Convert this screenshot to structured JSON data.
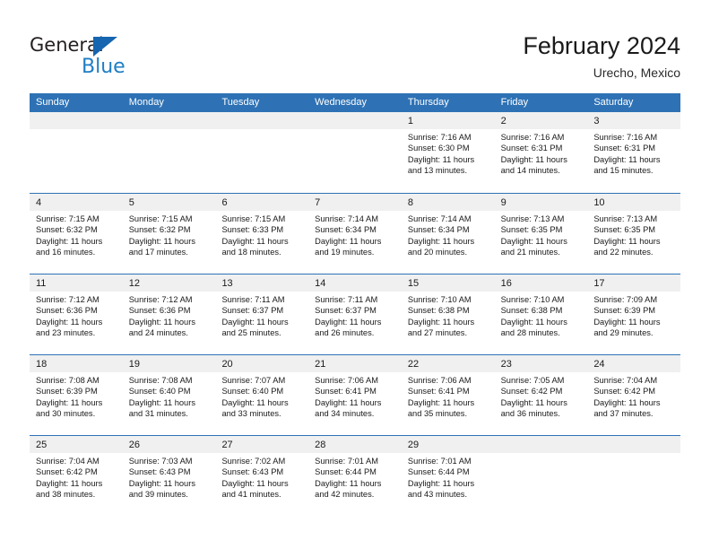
{
  "brand": {
    "name_part1": "General",
    "name_part2": "Blue",
    "triangle_icon": "blue-triangle-icon",
    "accent_color": "#1f7ec4"
  },
  "header": {
    "title": "February 2024",
    "subtitle": "Urecho, Mexico"
  },
  "theme": {
    "header_row_bg": "#2e72b5",
    "day_strip_bg": "#f0f0f0",
    "row_divider": "#2e72b5",
    "text": "#1a1a1a"
  },
  "weekdays": [
    "Sunday",
    "Monday",
    "Tuesday",
    "Wednesday",
    "Thursday",
    "Friday",
    "Saturday"
  ],
  "weeks": [
    [
      {
        "day": "",
        "sunrise": "",
        "sunset": "",
        "daylight_line1": "",
        "daylight_line2": ""
      },
      {
        "day": "",
        "sunrise": "",
        "sunset": "",
        "daylight_line1": "",
        "daylight_line2": ""
      },
      {
        "day": "",
        "sunrise": "",
        "sunset": "",
        "daylight_line1": "",
        "daylight_line2": ""
      },
      {
        "day": "",
        "sunrise": "",
        "sunset": "",
        "daylight_line1": "",
        "daylight_line2": ""
      },
      {
        "day": "1",
        "sunrise": "Sunrise: 7:16 AM",
        "sunset": "Sunset: 6:30 PM",
        "daylight_line1": "Daylight: 11 hours",
        "daylight_line2": "and 13 minutes."
      },
      {
        "day": "2",
        "sunrise": "Sunrise: 7:16 AM",
        "sunset": "Sunset: 6:31 PM",
        "daylight_line1": "Daylight: 11 hours",
        "daylight_line2": "and 14 minutes."
      },
      {
        "day": "3",
        "sunrise": "Sunrise: 7:16 AM",
        "sunset": "Sunset: 6:31 PM",
        "daylight_line1": "Daylight: 11 hours",
        "daylight_line2": "and 15 minutes."
      }
    ],
    [
      {
        "day": "4",
        "sunrise": "Sunrise: 7:15 AM",
        "sunset": "Sunset: 6:32 PM",
        "daylight_line1": "Daylight: 11 hours",
        "daylight_line2": "and 16 minutes."
      },
      {
        "day": "5",
        "sunrise": "Sunrise: 7:15 AM",
        "sunset": "Sunset: 6:32 PM",
        "daylight_line1": "Daylight: 11 hours",
        "daylight_line2": "and 17 minutes."
      },
      {
        "day": "6",
        "sunrise": "Sunrise: 7:15 AM",
        "sunset": "Sunset: 6:33 PM",
        "daylight_line1": "Daylight: 11 hours",
        "daylight_line2": "and 18 minutes."
      },
      {
        "day": "7",
        "sunrise": "Sunrise: 7:14 AM",
        "sunset": "Sunset: 6:34 PM",
        "daylight_line1": "Daylight: 11 hours",
        "daylight_line2": "and 19 minutes."
      },
      {
        "day": "8",
        "sunrise": "Sunrise: 7:14 AM",
        "sunset": "Sunset: 6:34 PM",
        "daylight_line1": "Daylight: 11 hours",
        "daylight_line2": "and 20 minutes."
      },
      {
        "day": "9",
        "sunrise": "Sunrise: 7:13 AM",
        "sunset": "Sunset: 6:35 PM",
        "daylight_line1": "Daylight: 11 hours",
        "daylight_line2": "and 21 minutes."
      },
      {
        "day": "10",
        "sunrise": "Sunrise: 7:13 AM",
        "sunset": "Sunset: 6:35 PM",
        "daylight_line1": "Daylight: 11 hours",
        "daylight_line2": "and 22 minutes."
      }
    ],
    [
      {
        "day": "11",
        "sunrise": "Sunrise: 7:12 AM",
        "sunset": "Sunset: 6:36 PM",
        "daylight_line1": "Daylight: 11 hours",
        "daylight_line2": "and 23 minutes."
      },
      {
        "day": "12",
        "sunrise": "Sunrise: 7:12 AM",
        "sunset": "Sunset: 6:36 PM",
        "daylight_line1": "Daylight: 11 hours",
        "daylight_line2": "and 24 minutes."
      },
      {
        "day": "13",
        "sunrise": "Sunrise: 7:11 AM",
        "sunset": "Sunset: 6:37 PM",
        "daylight_line1": "Daylight: 11 hours",
        "daylight_line2": "and 25 minutes."
      },
      {
        "day": "14",
        "sunrise": "Sunrise: 7:11 AM",
        "sunset": "Sunset: 6:37 PM",
        "daylight_line1": "Daylight: 11 hours",
        "daylight_line2": "and 26 minutes."
      },
      {
        "day": "15",
        "sunrise": "Sunrise: 7:10 AM",
        "sunset": "Sunset: 6:38 PM",
        "daylight_line1": "Daylight: 11 hours",
        "daylight_line2": "and 27 minutes."
      },
      {
        "day": "16",
        "sunrise": "Sunrise: 7:10 AM",
        "sunset": "Sunset: 6:38 PM",
        "daylight_line1": "Daylight: 11 hours",
        "daylight_line2": "and 28 minutes."
      },
      {
        "day": "17",
        "sunrise": "Sunrise: 7:09 AM",
        "sunset": "Sunset: 6:39 PM",
        "daylight_line1": "Daylight: 11 hours",
        "daylight_line2": "and 29 minutes."
      }
    ],
    [
      {
        "day": "18",
        "sunrise": "Sunrise: 7:08 AM",
        "sunset": "Sunset: 6:39 PM",
        "daylight_line1": "Daylight: 11 hours",
        "daylight_line2": "and 30 minutes."
      },
      {
        "day": "19",
        "sunrise": "Sunrise: 7:08 AM",
        "sunset": "Sunset: 6:40 PM",
        "daylight_line1": "Daylight: 11 hours",
        "daylight_line2": "and 31 minutes."
      },
      {
        "day": "20",
        "sunrise": "Sunrise: 7:07 AM",
        "sunset": "Sunset: 6:40 PM",
        "daylight_line1": "Daylight: 11 hours",
        "daylight_line2": "and 33 minutes."
      },
      {
        "day": "21",
        "sunrise": "Sunrise: 7:06 AM",
        "sunset": "Sunset: 6:41 PM",
        "daylight_line1": "Daylight: 11 hours",
        "daylight_line2": "and 34 minutes."
      },
      {
        "day": "22",
        "sunrise": "Sunrise: 7:06 AM",
        "sunset": "Sunset: 6:41 PM",
        "daylight_line1": "Daylight: 11 hours",
        "daylight_line2": "and 35 minutes."
      },
      {
        "day": "23",
        "sunrise": "Sunrise: 7:05 AM",
        "sunset": "Sunset: 6:42 PM",
        "daylight_line1": "Daylight: 11 hours",
        "daylight_line2": "and 36 minutes."
      },
      {
        "day": "24",
        "sunrise": "Sunrise: 7:04 AM",
        "sunset": "Sunset: 6:42 PM",
        "daylight_line1": "Daylight: 11 hours",
        "daylight_line2": "and 37 minutes."
      }
    ],
    [
      {
        "day": "25",
        "sunrise": "Sunrise: 7:04 AM",
        "sunset": "Sunset: 6:42 PM",
        "daylight_line1": "Daylight: 11 hours",
        "daylight_line2": "and 38 minutes."
      },
      {
        "day": "26",
        "sunrise": "Sunrise: 7:03 AM",
        "sunset": "Sunset: 6:43 PM",
        "daylight_line1": "Daylight: 11 hours",
        "daylight_line2": "and 39 minutes."
      },
      {
        "day": "27",
        "sunrise": "Sunrise: 7:02 AM",
        "sunset": "Sunset: 6:43 PM",
        "daylight_line1": "Daylight: 11 hours",
        "daylight_line2": "and 41 minutes."
      },
      {
        "day": "28",
        "sunrise": "Sunrise: 7:01 AM",
        "sunset": "Sunset: 6:44 PM",
        "daylight_line1": "Daylight: 11 hours",
        "daylight_line2": "and 42 minutes."
      },
      {
        "day": "29",
        "sunrise": "Sunrise: 7:01 AM",
        "sunset": "Sunset: 6:44 PM",
        "daylight_line1": "Daylight: 11 hours",
        "daylight_line2": "and 43 minutes."
      },
      {
        "day": "",
        "sunrise": "",
        "sunset": "",
        "daylight_line1": "",
        "daylight_line2": ""
      },
      {
        "day": "",
        "sunrise": "",
        "sunset": "",
        "daylight_line1": "",
        "daylight_line2": ""
      }
    ]
  ]
}
